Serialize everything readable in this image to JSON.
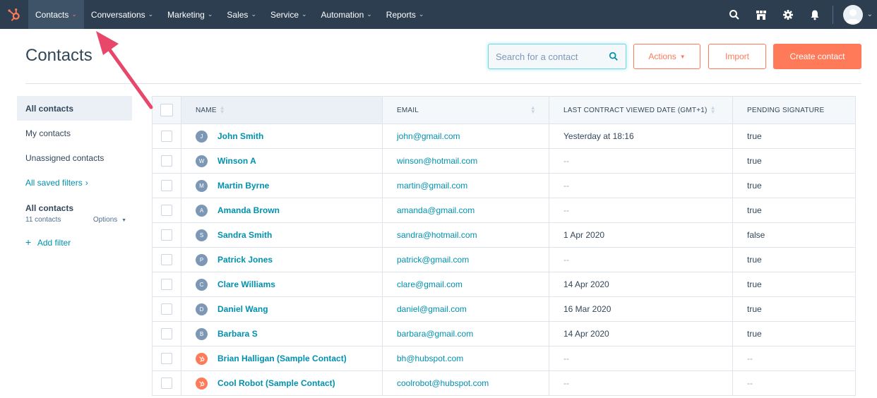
{
  "nav": {
    "items": [
      {
        "label": "Contacts",
        "active": true
      },
      {
        "label": "Conversations",
        "active": false
      },
      {
        "label": "Marketing",
        "active": false
      },
      {
        "label": "Sales",
        "active": false
      },
      {
        "label": "Service",
        "active": false
      },
      {
        "label": "Automation",
        "active": false
      },
      {
        "label": "Reports",
        "active": false
      }
    ],
    "caret": "⌄",
    "icons": [
      "search-icon",
      "marketplace-icon",
      "settings-icon",
      "notifications-icon",
      "user-avatar-icon"
    ]
  },
  "header": {
    "title": "Contacts",
    "search_placeholder": "Search for a contact",
    "actions_label": "Actions",
    "import_label": "Import",
    "create_label": "Create contact"
  },
  "sidebar": {
    "items": [
      {
        "label": "All contacts",
        "active": true
      },
      {
        "label": "My contacts",
        "active": false
      },
      {
        "label": "Unassigned contacts",
        "active": false
      }
    ],
    "saved_filters": "All saved filters",
    "group_title": "All contacts",
    "group_count": "11 contacts",
    "options_label": "Options",
    "add_filter": "Add filter"
  },
  "table": {
    "columns": [
      "NAME",
      "EMAIL",
      "LAST CONTRACT VIEWED DATE (GMT+1)",
      "PENDING SIGNATURE"
    ],
    "rows": [
      {
        "initial": "J",
        "name": "John Smith",
        "email": "john@gmail.com",
        "date": "Yesterday at 18:16",
        "pending": "true",
        "sample": false
      },
      {
        "initial": "W",
        "name": "Winson A",
        "email": "winson@hotmail.com",
        "date": "--",
        "pending": "true",
        "sample": false
      },
      {
        "initial": "M",
        "name": "Martin Byrne",
        "email": "martin@gmail.com",
        "date": "--",
        "pending": "true",
        "sample": false
      },
      {
        "initial": "A",
        "name": "Amanda Brown",
        "email": "amanda@gmail.com",
        "date": "--",
        "pending": "true",
        "sample": false
      },
      {
        "initial": "S",
        "name": "Sandra Smith",
        "email": "sandra@hotmail.com",
        "date": "1 Apr 2020",
        "pending": "false",
        "sample": false
      },
      {
        "initial": "P",
        "name": "Patrick Jones",
        "email": "patrick@gmail.com",
        "date": "--",
        "pending": "true",
        "sample": false
      },
      {
        "initial": "C",
        "name": "Clare Williams",
        "email": "clare@gmail.com",
        "date": "14 Apr 2020",
        "pending": "true",
        "sample": false
      },
      {
        "initial": "D",
        "name": "Daniel Wang",
        "email": "daniel@gmail.com",
        "date": "16 Mar 2020",
        "pending": "true",
        "sample": false
      },
      {
        "initial": "B",
        "name": "Barbara S",
        "email": "barbara@gmail.com",
        "date": "14 Apr 2020",
        "pending": "true",
        "sample": false
      },
      {
        "initial": "",
        "name": "Brian Halligan (Sample Contact)",
        "email": "bh@hubspot.com",
        "date": "--",
        "pending": "--",
        "sample": true
      },
      {
        "initial": "",
        "name": "Cool Robot (Sample Contact)",
        "email": "coolrobot@hubspot.com",
        "date": "--",
        "pending": "--",
        "sample": true
      }
    ]
  },
  "colors": {
    "nav_bg": "#2d3e50",
    "accent": "#ff7a59",
    "link": "#0091ae",
    "annotation_arrow": "#e8476a"
  }
}
